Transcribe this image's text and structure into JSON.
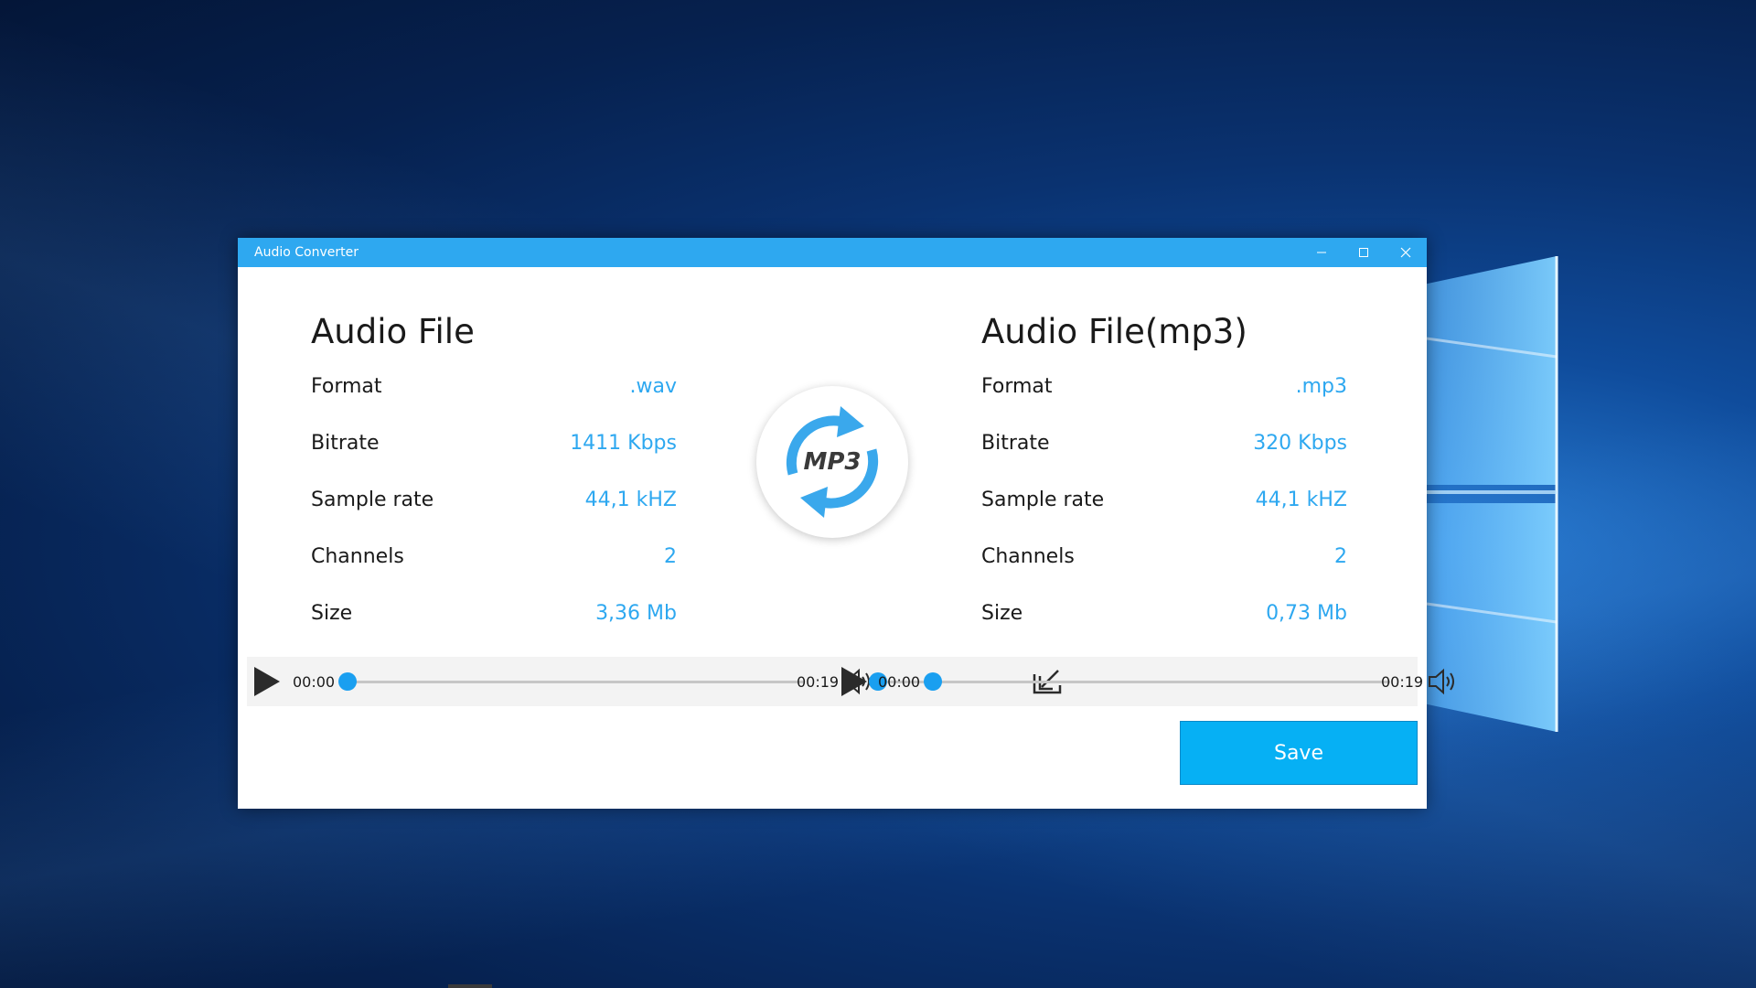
{
  "window": {
    "title": "Audio Converter",
    "controls": [
      "minimize-icon",
      "maximize-icon",
      "close-icon"
    ],
    "accent": "#2ea8f0"
  },
  "source": {
    "heading": "Audio File",
    "rows": [
      {
        "label": "Format",
        "value": ".wav"
      },
      {
        "label": "Bitrate",
        "value": "1411 Kbps"
      },
      {
        "label": "Sample rate",
        "value": "44,1 kHZ"
      },
      {
        "label": "Channels",
        "value": "2"
      },
      {
        "label": "Size",
        "value": "3,36 Mb"
      }
    ]
  },
  "target": {
    "heading": "Audio File(mp3)",
    "rows": [
      {
        "label": "Format",
        "value": ".mp3"
      },
      {
        "label": "Bitrate",
        "value": "320 Kbps"
      },
      {
        "label": "Sample rate",
        "value": "44,1 kHZ"
      },
      {
        "label": "Channels",
        "value": "2"
      },
      {
        "label": "Size",
        "value": "0,73 Mb"
      }
    ]
  },
  "logo": {
    "text": "MP3",
    "icon": "refresh-cycle-icon"
  },
  "player_left": {
    "current_time": "00:00",
    "total_time": "00:19",
    "progress_fraction": 0.0,
    "volume_fraction": 0.5
  },
  "player_right": {
    "current_time": "00:00",
    "total_time": "00:19",
    "progress_fraction": 0.0,
    "volume_fraction": 0.5
  },
  "buttons": {
    "save_label": "Save"
  },
  "colors": {
    "value_text": "#2ea8f0",
    "slider": "#1a9ff0",
    "save_button": "#06b0f4"
  }
}
